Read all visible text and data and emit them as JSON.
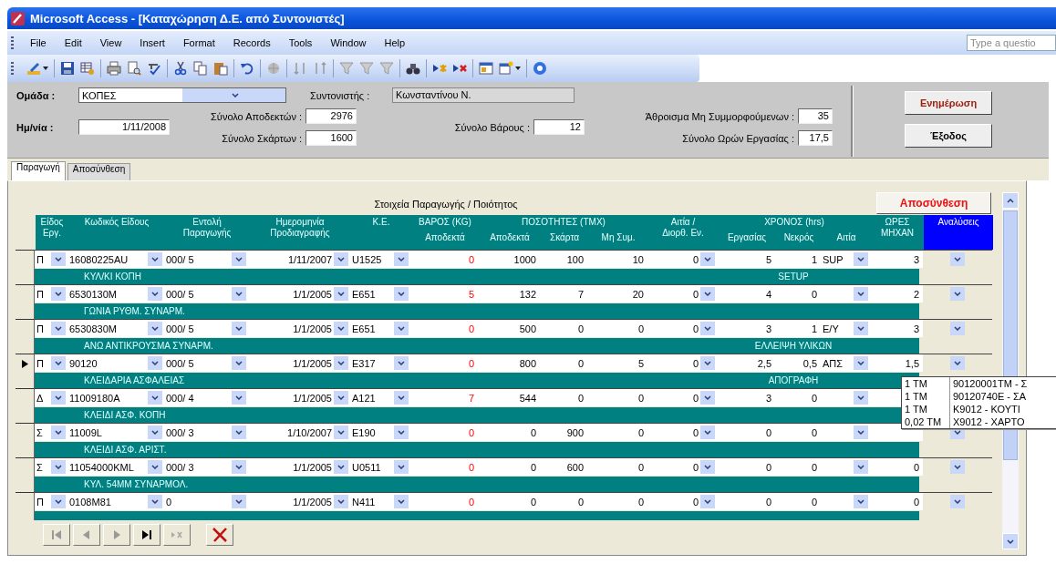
{
  "window": {
    "title": "Microsoft Access - [Καταχώρηση Δ.Ε. από Συντονιστές]"
  },
  "menu": [
    "File",
    "Edit",
    "View",
    "Insert",
    "Format",
    "Records",
    "Tools",
    "Window",
    "Help"
  ],
  "help_box": {
    "placeholder": "Type a questio"
  },
  "form": {
    "group": {
      "label": "Ομάδα :",
      "value": "ΚΟΠΕΣ"
    },
    "coordinator": {
      "label": "Συντονιστής :",
      "value": "Κωνσταντίνου Ν."
    },
    "date": {
      "label": "Ημ/νία :",
      "value": "1/11/2008"
    },
    "totals": [
      {
        "label": "Σύνολο Αποδεκτών :",
        "value": "2976"
      },
      {
        "label": "Σύνολο Σκάρτων :",
        "value": "1600"
      },
      {
        "label": "Σύνολο Βάρους :",
        "value": "12"
      },
      {
        "label": "Άθροισμα Μη Συμμορφούμενων :",
        "value": "35"
      },
      {
        "label": "Σύνολο Ωρών Εργασίας :",
        "value": "17,5"
      }
    ],
    "buttons": [
      "Ενημέρωση",
      "Έξοδος"
    ]
  },
  "tabs": [
    {
      "label": "Παραγωγή",
      "selected": true
    },
    {
      "label": "Αποσύνθεση",
      "selected": false
    }
  ],
  "panel": {
    "caption": "Στοιχεία Παραγωγής / Ποιότητος",
    "button": "Αποσύνθεση"
  },
  "grid": {
    "header": [
      {
        "kind": "single",
        "lines": [
          "Είδος",
          "Εργ."
        ]
      },
      {
        "kind": "single",
        "lines": [
          "Κωδικός Είδους"
        ]
      },
      {
        "kind": "single",
        "lines": [
          "Εντολή",
          "Παραγωγής"
        ]
      },
      {
        "kind": "single",
        "lines": [
          "Ημερομηνία",
          "Προδιαγραφής"
        ]
      },
      {
        "kind": "single",
        "lines": [
          "Κ.Ε."
        ]
      },
      {
        "kind": "group",
        "label": "ΒΑΡΟΣ (KG)",
        "columns": [
          "Αποδεκτά"
        ]
      },
      {
        "kind": "group",
        "label": "ΠΟΣΟΤΗΤΕΣ (ΤΜΧ)",
        "columns": [
          "Αποδεκτά",
          "Σκάρτα",
          "Μη Συμ."
        ]
      },
      {
        "kind": "single",
        "lines": [
          "Αιτία /",
          "Διορθ. Εν."
        ]
      },
      {
        "kind": "group",
        "label": "ΧΡΟΝΟΣ (hrs)",
        "columns": [
          "Εργασίας",
          "Νεκρός",
          "Αιτία"
        ]
      },
      {
        "kind": "single",
        "lines": [
          "ΩΡΕΣ",
          "ΜΗΧΑΝ"
        ]
      },
      {
        "kind": "highlight",
        "lines": [
          "Αναλύσεις"
        ]
      }
    ],
    "rows": [
      {
        "current": false,
        "type": "Π",
        "code": "16080225AU",
        "order": "000/ 5",
        "date": "1/11/2007",
        "cost_center": "U1525",
        "weight": "0",
        "accepted": "1000",
        "scrap": "100",
        "nonconforming": "10",
        "correction": "0",
        "work_hours": "5",
        "dead_hours": "1",
        "cause": "SUP",
        "machine_hours": "3",
        "description": "ΚΥΛ/ΚΙ ΚΟΠΗ",
        "cause_text": "SETUP"
      },
      {
        "current": false,
        "type": "Π",
        "code": "6530130M",
        "order": "000/ 5",
        "date": "1/1/2005",
        "cost_center": "E651",
        "weight": "5",
        "accepted": "132",
        "scrap": "7",
        "nonconforming": "20",
        "correction": "0",
        "work_hours": "4",
        "dead_hours": "0",
        "machine_hours": "2",
        "description": "ΓΩΝΙΑ ΡΥΘΜ. ΣΥΝΑΡΜ."
      },
      {
        "current": false,
        "type": "Π",
        "code": "6530830M",
        "order": "000/ 5",
        "date": "1/1/2005",
        "cost_center": "E651",
        "weight": "0",
        "accepted": "500",
        "scrap": "0",
        "nonconforming": "0",
        "correction": "0",
        "work_hours": "3",
        "dead_hours": "1",
        "cause": "Ε/Υ",
        "machine_hours": "3",
        "description": "ΑΝΩ ΑΝΤΙΚΡΟΥΣΜΑ ΣΥΝΑΡΜ.",
        "cause_text": "ΕΛΛΕΙΨΗ ΥΛΙΚΩΝ"
      },
      {
        "current": true,
        "type": "Π",
        "code": "90120",
        "order": "000/ 5",
        "date": "1/1/2005",
        "cost_center": "E317",
        "weight": "0",
        "accepted": "800",
        "scrap": "0",
        "nonconforming": "5",
        "correction": "0",
        "work_hours": "2,5",
        "dead_hours": "0,5",
        "cause": "ΑΠΣ",
        "machine_hours": "1,5",
        "description": "ΚΛΕΙΔΑΡΙΑ ΑΣΦΑΛΕΙΑΣ",
        "cause_text": "ΑΠΟΓΡΑΦΗ"
      },
      {
        "current": false,
        "type": "Δ",
        "code": "11009180A",
        "order": "000/ 4",
        "date": "1/1/2005",
        "cost_center": "A121",
        "weight": "7",
        "accepted": "544",
        "scrap": "0",
        "nonconforming": "0",
        "correction": "0",
        "work_hours": "3",
        "dead_hours": "0",
        "description": "ΚΛΕΙΔΙ ΑΣΦ. ΚΟΠΗ"
      },
      {
        "current": false,
        "type": "Σ",
        "code": "11009L",
        "order": "000/ 3",
        "date": "1/10/2007",
        "cost_center": "E190",
        "weight": "0",
        "accepted": "0",
        "scrap": "900",
        "nonconforming": "0",
        "correction": "0",
        "work_hours": "0",
        "dead_hours": "0",
        "description": "ΚΛΕΙΔΙ ΑΣΦ. ΑΡΙΣΤ."
      },
      {
        "current": false,
        "type": "Σ",
        "code": "11054000KML",
        "order": "000/ 3",
        "date": "1/1/2005",
        "cost_center": "U0511",
        "weight": "0",
        "accepted": "0",
        "scrap": "600",
        "nonconforming": "0",
        "correction": "0",
        "work_hours": "0",
        "dead_hours": "0",
        "machine_hours": "0",
        "description": "ΚΥΛ. 54ΜΜ ΣΥΝΑΡΜΟΛ."
      },
      {
        "current": false,
        "type": "Π",
        "code": "0108M81",
        "order": "0",
        "date": "1/1/2005",
        "cost_center": "N411",
        "weight": "0",
        "accepted": "0",
        "scrap": "0",
        "nonconforming": "0",
        "correction": "0",
        "work_hours": "0",
        "dead_hours": "0",
        "machine_hours": "0"
      }
    ]
  },
  "popup": {
    "rows": [
      {
        "qty": "1 ΤΜ",
        "item": "90120001ΤΜ - Σ"
      },
      {
        "qty": "1 ΤΜ",
        "item": "90120740Ε - ΣΑ"
      },
      {
        "qty": "1 ΤΜ",
        "item": "Κ9012 - ΚΟΥΤΙ"
      },
      {
        "qty": "0,02 ΤΜ",
        "item": "Χ9012 - ΧΑΡΤΟ"
      }
    ]
  }
}
